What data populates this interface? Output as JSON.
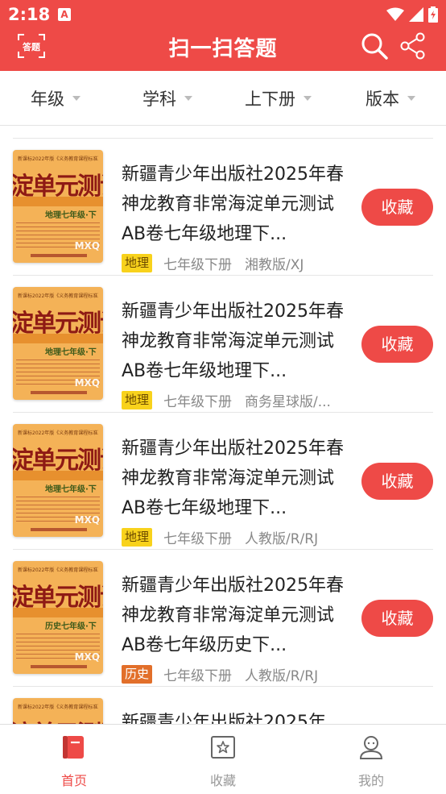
{
  "status": {
    "time": "2:18",
    "notification_glyph": "A"
  },
  "header": {
    "scan_label": "答题",
    "title": "扫一扫答题",
    "bg_color": "#ee4a47"
  },
  "filters": [
    {
      "label": "年级"
    },
    {
      "label": "学科"
    },
    {
      "label": "上下册"
    },
    {
      "label": "版本"
    }
  ],
  "cover_text": {
    "top": "新课标2022年版《义务教育课程标准》编写",
    "big": "淀单元测试AB",
    "watermark": "MXQ"
  },
  "items": [
    {
      "title": "新疆青少年出版社2025年春神龙教育非常海淀单元测试AB卷七年级地理下...",
      "tag": "地理",
      "tag_type": "geo",
      "grade": "七年级下册",
      "version": "湘教版/XJ",
      "cover_sub": "地理七年级·下",
      "button": "收藏"
    },
    {
      "title": "新疆青少年出版社2025年春神龙教育非常海淀单元测试AB卷七年级地理下...",
      "tag": "地理",
      "tag_type": "geo",
      "grade": "七年级下册",
      "version": "商务星球版/...",
      "cover_sub": "地理七年级·下",
      "button": "收藏"
    },
    {
      "title": "新疆青少年出版社2025年春神龙教育非常海淀单元测试AB卷七年级地理下...",
      "tag": "地理",
      "tag_type": "geo",
      "grade": "七年级下册",
      "version": "人教版/R/RJ",
      "cover_sub": "地理七年级·下",
      "button": "收藏"
    },
    {
      "title": "新疆青少年出版社2025年春神龙教育非常海淀单元测试AB卷七年级历史下...",
      "tag": "历史",
      "tag_type": "his",
      "grade": "七年级下册",
      "version": "人教版/R/RJ",
      "cover_sub": "历史七年级·下",
      "button": "收藏"
    },
    {
      "title": "新疆青少年出版社2025年",
      "tag": "",
      "tag_type": "",
      "grade": "",
      "version": "",
      "cover_sub": "",
      "button": ""
    }
  ],
  "tabs": [
    {
      "label": "首页",
      "icon": "home-book-icon",
      "active": true
    },
    {
      "label": "收藏",
      "icon": "star-box-icon",
      "active": false
    },
    {
      "label": "我的",
      "icon": "user-icon",
      "active": false
    }
  ],
  "colors": {
    "accent": "#ee4a47",
    "tab_inactive": "#999999",
    "tag_geography": "#f8d21c",
    "tag_history": "#e26f2a"
  }
}
